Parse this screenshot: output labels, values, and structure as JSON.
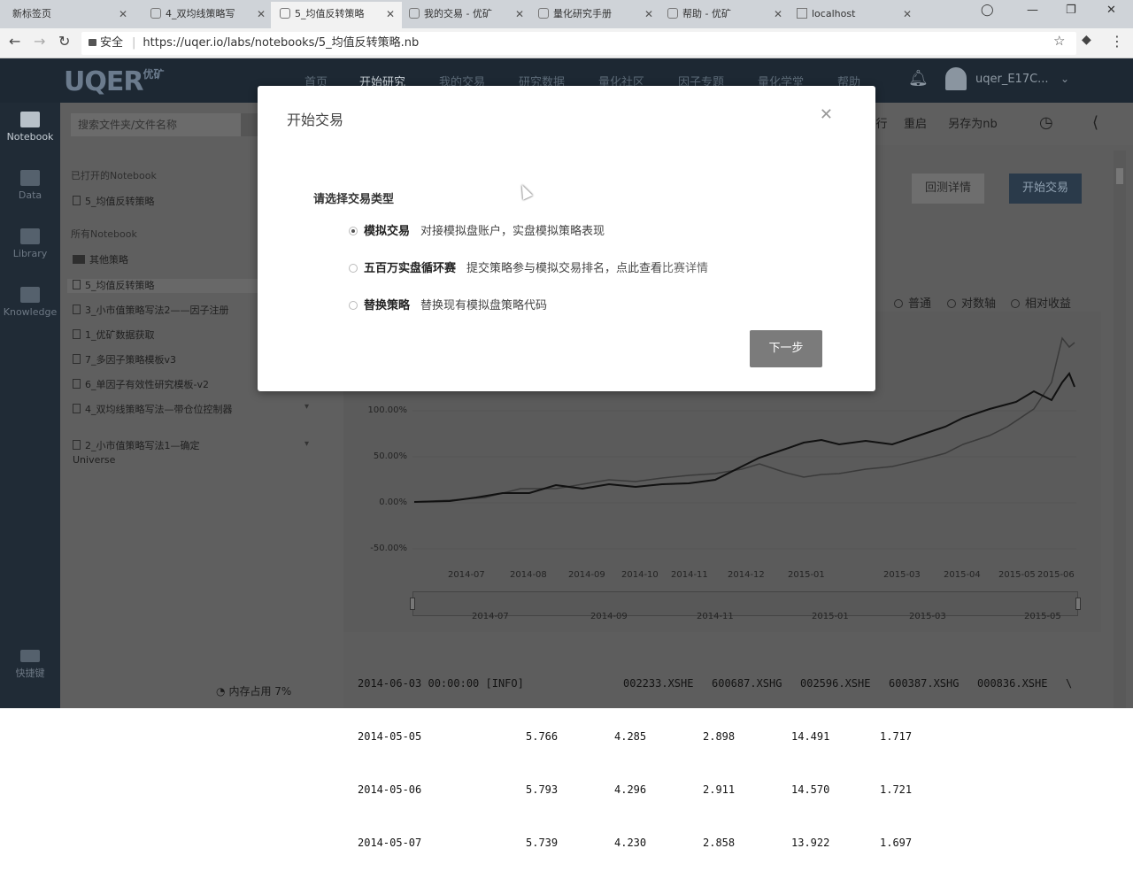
{
  "browser": {
    "tabs": [
      {
        "label": "新标签页"
      },
      {
        "label": "4_双均线策略写"
      },
      {
        "label": "5_均值反转策略"
      },
      {
        "label": "我的交易 - 优矿"
      },
      {
        "label": "量化研究手册"
      },
      {
        "label": "帮助 - 优矿"
      },
      {
        "label": "localhost"
      }
    ],
    "security_label": "安全",
    "url": "https://uqer.io/labs/notebooks/5_均值反转策略.nb"
  },
  "app": {
    "logo_text": "UQER",
    "logo_sub": "优矿",
    "nav": [
      "首页",
      "开始研究",
      "我的交易",
      "研究数据",
      "量化社区",
      "因子专题",
      "量化学堂",
      "帮助"
    ],
    "user_name": "uqer_E17C..."
  },
  "rail": {
    "items": [
      "Notebook",
      "Data",
      "Library",
      "Knowledge"
    ],
    "shortcut": "快捷键"
  },
  "files": {
    "search_placeholder": "搜索文件夹/文件名称",
    "opened_title": "已打开的Notebook",
    "opened_items": [
      "5_均值反转策略"
    ],
    "all_title": "所有Notebook",
    "folder": "其他策略",
    "items": [
      "5_均值反转策略",
      "3_小市值策略写法2——因子注册",
      "1_优矿数据获取",
      "7_多因子策略模板v3",
      "6_单因子有效性研究模板-v2",
      "4_双均线策略写法—带仓位控制器",
      "2_小市值策略写法1—确定Universe"
    ],
    "memory": "内存占用 7%"
  },
  "main": {
    "toolbar": [
      "行",
      "重启",
      "另存为nb"
    ],
    "backtest_button": "回测详情",
    "start_trade_button": "开始交易",
    "legend": [
      "普通",
      "对数轴",
      "相对收益"
    ],
    "yticks": [
      "100.00%",
      "50.00%",
      "0.00%",
      "-50.00%"
    ],
    "xticks": [
      "2014-07",
      "2014-08",
      "2014-09",
      "2014-10",
      "2014-11",
      "2014-12",
      "2015-01",
      "2015-03",
      "2015-04",
      "2015-05",
      "2015-06"
    ],
    "nav_ticks": [
      "2014-07",
      "2014-09",
      "2014-11",
      "2015-01",
      "2015-03",
      "2015-05"
    ],
    "dataframe": {
      "header": [
        "2014-06-03 00:00:00 [INFO]",
        "002233.XSHE",
        "600687.XSHG",
        "002596.XSHE",
        "600387.XSHG",
        "000836.XSHE",
        "\\"
      ],
      "rows": [
        [
          "2014-05-05",
          "5.766",
          "4.285",
          "2.898",
          "14.491",
          "1.717"
        ],
        [
          "2014-05-06",
          "5.793",
          "4.296",
          "2.911",
          "14.570",
          "1.721"
        ],
        [
          "2014-05-07",
          "5.739",
          "4.230",
          "2.858",
          "13.922",
          "1.697"
        ]
      ]
    }
  },
  "modal": {
    "title": "开始交易",
    "prompt": "请选择交易类型",
    "options": [
      {
        "name": "模拟交易",
        "desc": "对接模拟盘账户，实盘模拟策略表现",
        "link": ""
      },
      {
        "name": "五百万实盘循环赛",
        "desc": "提交策略参与模拟交易排名，点此查看",
        "link": "比赛详情"
      },
      {
        "name": "替换策略",
        "desc": "替换现有模拟盘策略代码",
        "link": ""
      }
    ],
    "selected": "模拟交易",
    "next_button": "下一步"
  }
}
